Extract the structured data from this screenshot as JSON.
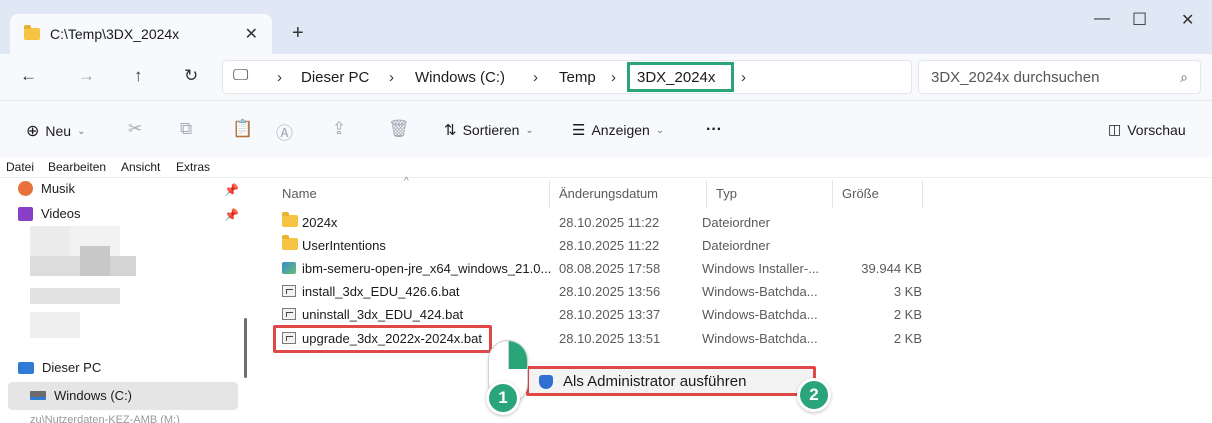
{
  "window": {
    "tab_title": "C:\\Temp\\3DX_2024x",
    "tab_close": "✕",
    "new_tab": "+",
    "minimize": "—",
    "maximize": "☐",
    "close": "✕"
  },
  "address": {
    "breadcrumbs": [
      "Dieser PC",
      "Windows (C:)",
      "Temp",
      "3DX_2024x"
    ],
    "search_placeholder": "3DX_2024x durchsuchen"
  },
  "commands": {
    "new": "Neu",
    "sort": "Sortieren",
    "view": "Anzeigen",
    "more": "···",
    "preview": "Vorschau"
  },
  "menu": [
    "Datei",
    "Bearbeiten",
    "Ansicht",
    "Extras"
  ],
  "sidebar": {
    "items": [
      {
        "label": "Musik",
        "icon": "music-icon",
        "pinned": true
      },
      {
        "label": "Videos",
        "icon": "videos-icon",
        "pinned": true
      }
    ],
    "this_pc": "Dieser PC",
    "drive": "Windows (C:)",
    "partial": "zu\\Nutzerdaten-KEZ-AMB (M:)"
  },
  "columns": [
    "Name",
    "Änderungsdatum",
    "Typ",
    "Größe"
  ],
  "files": [
    {
      "name": "2024x",
      "date": "28.10.2025 11:22",
      "type": "Dateiordner",
      "size": "",
      "icon": "folder-icon"
    },
    {
      "name": "UserIntentions",
      "date": "28.10.2025 11:22",
      "type": "Dateiordner",
      "size": "",
      "icon": "folder-icon"
    },
    {
      "name": "ibm-semeru-open-jre_x64_windows_21.0...",
      "date": "08.08.2025 17:58",
      "type": "Windows Installer-...",
      "size": "39.944 KB",
      "icon": "installer-icon"
    },
    {
      "name": "install_3dx_EDU_426.6.bat",
      "date": "28.10.2025 13:56",
      "type": "Windows-Batchda...",
      "size": "3 KB",
      "icon": "batch-file-icon"
    },
    {
      "name": "uninstall_3dx_EDU_424.bat",
      "date": "28.10.2025 13:37",
      "type": "Windows-Batchda...",
      "size": "2 KB",
      "icon": "batch-file-icon"
    },
    {
      "name": "upgrade_3dx_2022x-2024x.bat",
      "date": "28.10.2025 13:51",
      "type": "Windows-Batchda...",
      "size": "2 KB",
      "icon": "batch-file-icon"
    }
  ],
  "context_menu": {
    "run_as_admin": "Als Administrator ausführen"
  },
  "steps": [
    "1",
    "2"
  ],
  "colors": {
    "highlight_green": "#2aa57a",
    "highlight_red": "#e04848"
  }
}
